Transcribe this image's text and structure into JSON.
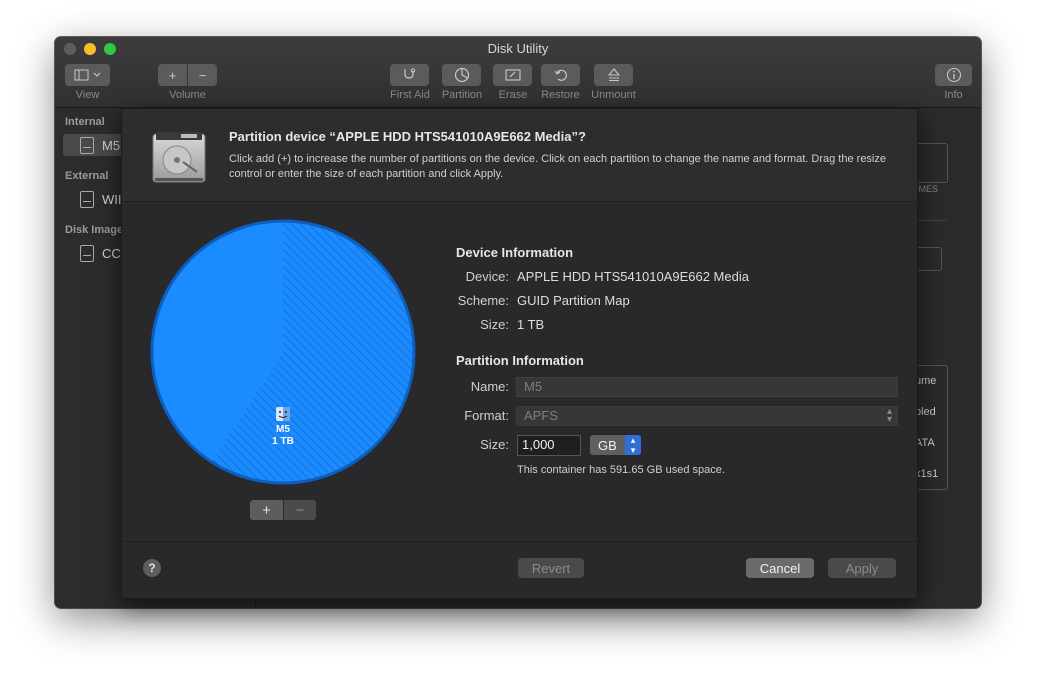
{
  "window": {
    "title": "Disk Utility"
  },
  "toolbar": {
    "view_label": "View",
    "volume_label": "Volume",
    "first_aid_label": "First Aid",
    "partition_label": "Partition",
    "erase_label": "Erase",
    "restore_label": "Restore",
    "unmount_label": "Unmount",
    "info_label": "Info"
  },
  "sidebar": {
    "internal_header": "Internal",
    "internal_item": "M5",
    "external_header": "External",
    "external_item": "WII",
    "images_header": "Disk Image",
    "images_item": "CC"
  },
  "background_panel": {
    "volumes_fragment": "UMES",
    "row1": "ume",
    "row2": "bled",
    "row3": "ATA",
    "row4": "k1s1"
  },
  "sheet": {
    "title": "Partition device “APPLE HDD HTS541010A9E662 Media”?",
    "description": "Click add (+) to increase the number of partitions on the device. Click on each partition to change the name and format. Drag the resize control or enter the size of each partition and click Apply.",
    "pie": {
      "partition_name": "M5",
      "partition_size": "1 TB",
      "used_fraction": 0.59165,
      "colors": {
        "fill": "#1a8cff",
        "used_hatch": "#1f6fd0",
        "border": "#0b5fbf"
      }
    },
    "plus_label": "+",
    "minus_label": "−",
    "device_info": {
      "heading": "Device Information",
      "device_label": "Device:",
      "device_value": "APPLE HDD HTS541010A9E662 Media",
      "scheme_label": "Scheme:",
      "scheme_value": "GUID Partition Map",
      "size_label": "Size:",
      "size_value": "1 TB"
    },
    "partition_info": {
      "heading": "Partition Information",
      "name_label": "Name:",
      "name_value": "M5",
      "format_label": "Format:",
      "format_value": "APFS",
      "size_label": "Size:",
      "size_value": "1,000",
      "size_unit": "GB",
      "note": "This container has 591.65 GB used space."
    },
    "help_label": "?",
    "revert_label": "Revert",
    "cancel_label": "Cancel",
    "apply_label": "Apply"
  }
}
